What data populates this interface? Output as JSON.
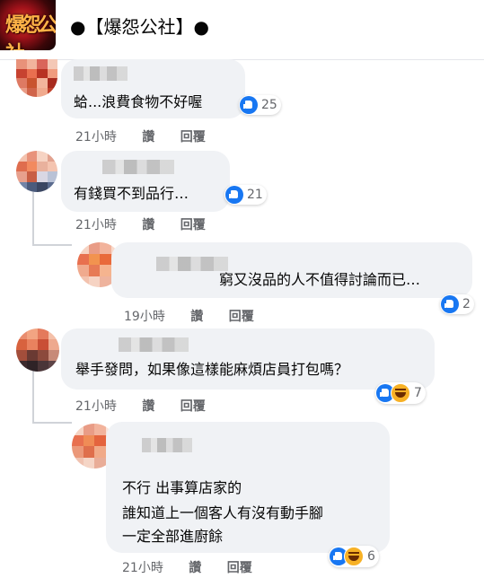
{
  "header": {
    "title": "●【爆怨公社】●"
  },
  "page_avatar_text": "爆怨公社",
  "comments": [
    {
      "text": "蛤...浪費食物不好喔",
      "reactions": "25",
      "time": "21小時",
      "like_label": "讚",
      "reply_label": "回覆"
    },
    {
      "text": "有錢買不到品行…",
      "reactions": "21",
      "time": "21小時",
      "like_label": "讚",
      "reply_label": "回覆"
    },
    {
      "text": "窮又沒品的人不值得討論而已…",
      "reactions": "2",
      "time": "19小時",
      "like_label": "讚",
      "reply_label": "回覆"
    },
    {
      "text": "舉手發問，如果像這樣能麻煩店員打包嗎？",
      "reactions": "7",
      "time": "21小時",
      "like_label": "讚",
      "reply_label": "回覆"
    },
    {
      "lines": [
        "不行 出事算店家的",
        "誰知道上一個客人有沒有動手腳",
        "一定全部進廚餘"
      ],
      "reactions": "6",
      "time": "21小時",
      "like_label": "讚",
      "reply_label": "回覆"
    }
  ],
  "colors": {
    "like_blue": "#1877f2",
    "bubble_bg": "#f0f2f5",
    "meta_gray": "#65676b"
  },
  "icons": [
    "like-icon",
    "haha-icon"
  ]
}
